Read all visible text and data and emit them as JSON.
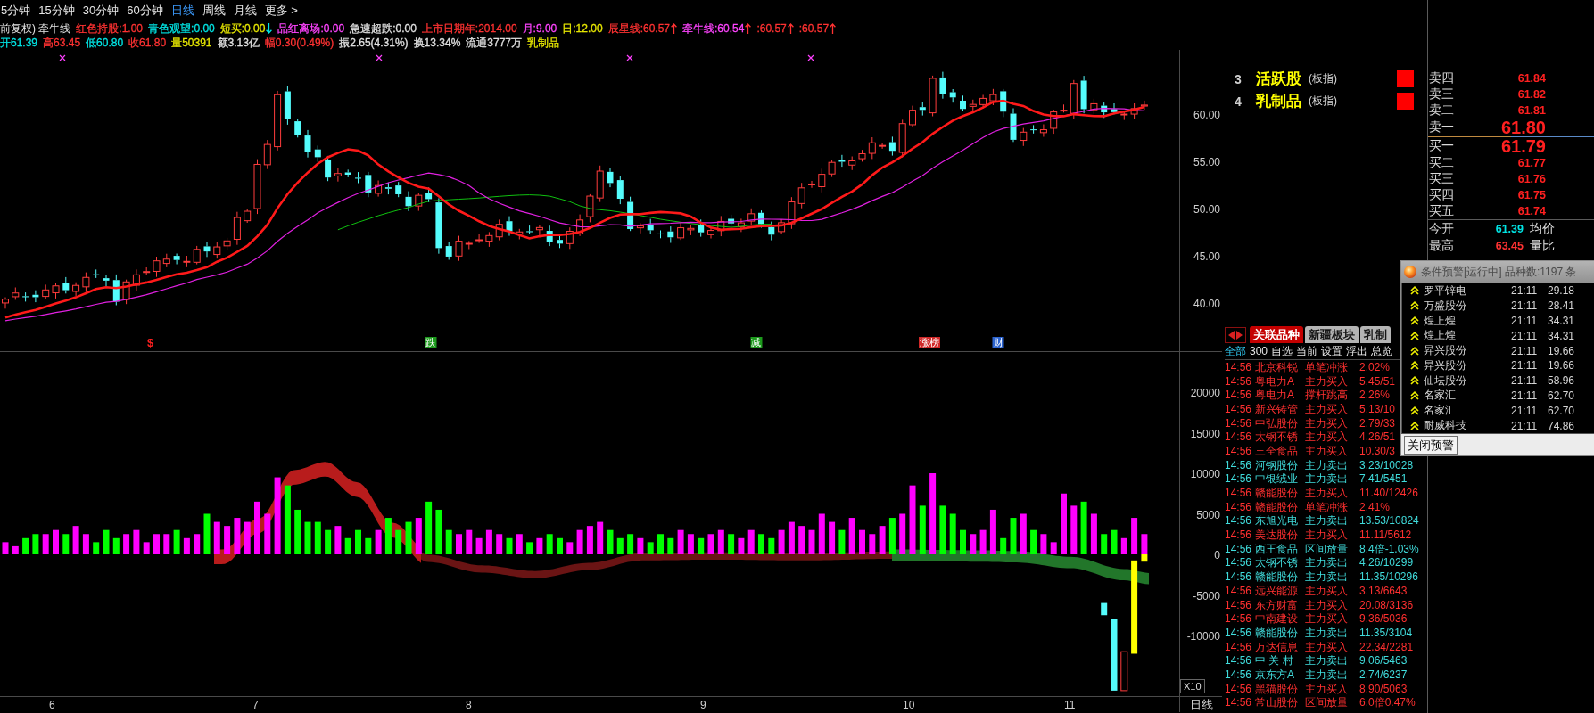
{
  "period_tabs": [
    {
      "label": "5分钟",
      "selected": false
    },
    {
      "label": "15分钟",
      "selected": false
    },
    {
      "label": "30分钟",
      "selected": false
    },
    {
      "label": "60分钟",
      "selected": false
    },
    {
      "label": "日线",
      "selected": true
    },
    {
      "label": "周线",
      "selected": false
    },
    {
      "label": "月线",
      "selected": false
    },
    {
      "label": "更多 >",
      "selected": false
    }
  ],
  "indicator_header": {
    "title": "前复权) 牵牛线",
    "values": [
      {
        "text": "红色持股:1.00",
        "color": "#ff3232",
        "kind": "plain"
      },
      {
        "text": "青色观望:0.00",
        "color": "#00e4e4",
        "kind": "plain"
      },
      {
        "text": "短买:0.00",
        "color": "#e6e600",
        "kind": "falling"
      },
      {
        "text": "品红离场:0.00",
        "color": "#ff44ff",
        "kind": "plain"
      },
      {
        "text": "急速超跌:0.00",
        "color": "#e0e0e0",
        "kind": "plain"
      },
      {
        "text": "上市日期年:2014.00",
        "color": "#ff3232",
        "kind": "plain"
      },
      {
        "text": "月:9.00",
        "color": "#ff44ff",
        "kind": "plain"
      },
      {
        "text": "日:12.00",
        "color": "#e6e600",
        "kind": "plain"
      },
      {
        "text": "辰星线:60.57",
        "color": "#ff3232",
        "kind": "rising"
      },
      {
        "text": "牵牛线:60.54",
        "color": "#ff44ff",
        "kind": "rising"
      },
      {
        "text": ":60.57",
        "color": "#ff3232",
        "kind": "rising"
      },
      {
        "text": ":60.57",
        "color": "#ff3232",
        "kind": "rising"
      }
    ]
  },
  "quote_header": [
    {
      "text": "开61.39",
      "color": "#00e4e4"
    },
    {
      "text": "高63.45",
      "color": "#ff3232"
    },
    {
      "text": "低60.80",
      "color": "#00e4e4"
    },
    {
      "text": "收61.80",
      "color": "#ff3232"
    },
    {
      "text": "量50391",
      "color": "#e6e600"
    },
    {
      "text": "额3.13亿",
      "color": "#e0e0e0"
    },
    {
      "text": "幅0.30(0.49%)",
      "color": "#ff3232"
    },
    {
      "text": "振2.65(4.31%)",
      "color": "#e0e0e0"
    },
    {
      "text": "换13.34%",
      "color": "#e0e0e0"
    },
    {
      "text": "流通3777万",
      "color": "#e0e0e0"
    },
    {
      "text": "乳制品",
      "color": "#e6e600"
    }
  ],
  "price_chart": {
    "axis_labels": [
      "60.00",
      "55.00",
      "50.00",
      "45.00",
      "40.00"
    ],
    "event_tags": [
      {
        "text": "$",
        "kind": "plain",
        "color": "#ff2020"
      },
      {
        "text": "跌",
        "kind": "badge",
        "color": "#1c9a1c"
      },
      {
        "text": "减",
        "kind": "badge",
        "color": "#1c9a1c"
      },
      {
        "text": "涨榜",
        "kind": "badge",
        "color": "#d02828"
      },
      {
        "text": "财",
        "kind": "badge",
        "color": "#2c64d0"
      }
    ]
  },
  "indicator_chart": {
    "axis_labels": [
      "20000",
      "15000",
      "10000",
      "5000",
      "0",
      "-5000",
      "-10000"
    ],
    "scale_label": "X10"
  },
  "time_axis": {
    "labels": [
      "6",
      "7",
      "8",
      "9",
      "10",
      "11"
    ],
    "period_label": "日线"
  },
  "sector_list": [
    {
      "rank": "3",
      "name": "活跃股",
      "type": "(板指)"
    },
    {
      "rank": "4",
      "name": "乳制品",
      "type": "(板指)"
    }
  ],
  "order_book": {
    "asks": [
      {
        "label": "卖四",
        "price": "61.84",
        "kind": "normal"
      },
      {
        "label": "卖三",
        "price": "61.82",
        "kind": "normal"
      },
      {
        "label": "卖二",
        "price": "61.81",
        "kind": "normal"
      },
      {
        "label": "卖一",
        "price": "61.80",
        "kind": "best"
      }
    ],
    "bids": [
      {
        "label": "买一",
        "price": "61.79",
        "kind": "best"
      },
      {
        "label": "买二",
        "price": "61.77",
        "kind": "normal"
      },
      {
        "label": "买三",
        "price": "61.76",
        "kind": "normal"
      },
      {
        "label": "买四",
        "price": "61.75",
        "kind": "normal"
      },
      {
        "label": "买五",
        "price": "61.74",
        "kind": "normal"
      }
    ],
    "stats": [
      {
        "label": "今开",
        "value": "61.39",
        "color": "#00e4e4",
        "extra": "均价"
      },
      {
        "label": "最高",
        "value": "63.45",
        "color": "#ff3232",
        "extra": "量比"
      }
    ]
  },
  "signal_panel": {
    "tabs": [
      {
        "label": "关联品种",
        "selected": true
      },
      {
        "label": "新疆板块",
        "selected": false
      },
      {
        "label": "乳制",
        "selected": false
      }
    ],
    "filters": [
      {
        "label": "全部",
        "selected": true
      },
      {
        "label": "300",
        "selected": false
      },
      {
        "label": "自选",
        "selected": false
      },
      {
        "label": "当前",
        "selected": false
      },
      {
        "label": "设置",
        "selected": false
      },
      {
        "label": "浮出",
        "selected": false
      },
      {
        "label": "总览",
        "selected": false
      }
    ],
    "rows": [
      {
        "time": "14:56",
        "name": "北京科锐",
        "signal": "单笔冲涨",
        "value": "2.02%",
        "color": "#ff3030"
      },
      {
        "time": "14:56",
        "name": "粤电力A",
        "signal": "主力买入",
        "value": "5.45/51",
        "color": "#ff3030"
      },
      {
        "time": "14:56",
        "name": "粤电力A",
        "signal": "撑杆跳高",
        "value": "2.26%",
        "color": "#ff3030"
      },
      {
        "time": "14:56",
        "name": "新兴铸管",
        "signal": "主力买入",
        "value": "5.13/10",
        "color": "#ff3030"
      },
      {
        "time": "14:56",
        "name": "中弘股份",
        "signal": "主力买入",
        "value": "2.79/33",
        "color": "#ff3030"
      },
      {
        "time": "14:56",
        "name": "太钢不锈",
        "signal": "主力买入",
        "value": "4.26/51",
        "color": "#ff3030"
      },
      {
        "time": "14:56",
        "name": "三全食品",
        "signal": "主力买入",
        "value": "10.30/3",
        "color": "#ff3030"
      },
      {
        "time": "14:56",
        "name": "河钢股份",
        "signal": "主力卖出",
        "value": "3.23/10028",
        "color": "#40dcdc"
      },
      {
        "time": "14:56",
        "name": "中银绒业",
        "signal": "主力卖出",
        "value": "7.41/5451",
        "color": "#40dcdc"
      },
      {
        "time": "14:56",
        "name": "赣能股份",
        "signal": "主力买入",
        "value": "11.40/12426",
        "color": "#ff3030"
      },
      {
        "time": "14:56",
        "name": "赣能股份",
        "signal": "单笔冲涨",
        "value": "2.41%",
        "color": "#ff3030"
      },
      {
        "time": "14:56",
        "name": "东旭光电",
        "signal": "主力卖出",
        "value": "13.53/10824",
        "color": "#40dcdc"
      },
      {
        "time": "14:56",
        "name": "美达股份",
        "signal": "主力买入",
        "value": "11.11/5612",
        "color": "#ff3030"
      },
      {
        "time": "14:56",
        "name": "西王食品",
        "signal": "区间放量",
        "value": "8.4倍-1.03%",
        "color": "#40dcdc"
      },
      {
        "time": "14:56",
        "name": "太钢不锈",
        "signal": "主力卖出",
        "value": "4.26/10299",
        "color": "#40dcdc"
      },
      {
        "time": "14:56",
        "name": "赣能股份",
        "signal": "主力卖出",
        "value": "11.35/10296",
        "color": "#40dcdc"
      },
      {
        "time": "14:56",
        "name": "远兴能源",
        "signal": "主力买入",
        "value": "3.13/6643",
        "color": "#ff3030"
      },
      {
        "time": "14:56",
        "name": "东方财富",
        "signal": "主力买入",
        "value": "20.08/3136",
        "color": "#ff3030"
      },
      {
        "time": "14:56",
        "name": "中南建设",
        "signal": "主力买入",
        "value": "9.36/5036",
        "color": "#ff3030"
      },
      {
        "time": "14:56",
        "name": "赣能股份",
        "signal": "主力卖出",
        "value": "11.35/3104",
        "color": "#40dcdc"
      },
      {
        "time": "14:56",
        "name": "万达信息",
        "signal": "主力买入",
        "value": "22.34/2281",
        "color": "#ff3030"
      },
      {
        "time": "14:56",
        "name": "中 关 村",
        "signal": "主力卖出",
        "value": "9.06/5463",
        "color": "#40dcdc"
      },
      {
        "time": "14:56",
        "name": "京东方A",
        "signal": "主力卖出",
        "value": "2.74/6237",
        "color": "#40dcdc"
      },
      {
        "time": "14:56",
        "name": "黑猫股份",
        "signal": "主力买入",
        "value": "8.90/5063",
        "color": "#ff3030"
      },
      {
        "time": "14:56",
        "name": "常山股份",
        "signal": "区间放量",
        "value": "6.0倍0.47%",
        "color": "#ff3030"
      }
    ]
  },
  "alert_window": {
    "title": "条件预警[运行中] 品种数:1197 条",
    "rows": [
      {
        "name": "罗平锌电",
        "time": "21:11",
        "price": "29.18"
      },
      {
        "name": "万盛股份",
        "time": "21:11",
        "price": "28.41"
      },
      {
        "name": "煌上煌",
        "time": "21:11",
        "price": "34.31"
      },
      {
        "name": "煌上煌",
        "time": "21:11",
        "price": "34.31"
      },
      {
        "name": "昇兴股份",
        "time": "21:11",
        "price": "19.66"
      },
      {
        "name": "昇兴股份",
        "time": "21:11",
        "price": "19.66"
      },
      {
        "name": "仙坛股份",
        "time": "21:11",
        "price": "58.96"
      },
      {
        "name": "名家汇",
        "time": "21:11",
        "price": "62.70"
      },
      {
        "name": "名家汇",
        "time": "21:11",
        "price": "62.70"
      },
      {
        "name": "耐威科技",
        "time": "21:11",
        "price": "74.86"
      }
    ],
    "close_button": "关闭预警"
  }
}
